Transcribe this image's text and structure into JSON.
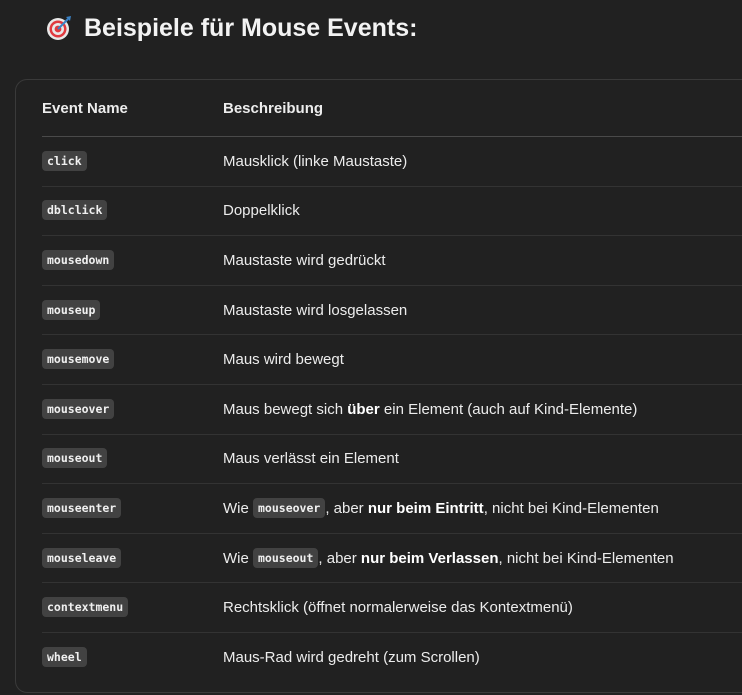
{
  "heading": {
    "icon": "direct-hit-target-icon",
    "title": "Beispiele für Mouse Events:"
  },
  "table": {
    "headers": [
      "Event Name",
      "Beschreibung"
    ],
    "rows": [
      {
        "event": "click",
        "description": [
          {
            "t": "Mausklick (linke Maustaste)"
          }
        ]
      },
      {
        "event": "dblclick",
        "description": [
          {
            "t": "Doppelklick"
          }
        ]
      },
      {
        "event": "mousedown",
        "description": [
          {
            "t": "Maustaste wird gedrückt"
          }
        ]
      },
      {
        "event": "mouseup",
        "description": [
          {
            "t": "Maustaste wird losgelassen"
          }
        ]
      },
      {
        "event": "mousemove",
        "description": [
          {
            "t": "Maus wird bewegt"
          }
        ]
      },
      {
        "event": "mouseover",
        "description": [
          {
            "t": "Maus bewegt sich "
          },
          {
            "b": "über"
          },
          {
            "t": " ein Element (auch auf Kind-Elemente)"
          }
        ]
      },
      {
        "event": "mouseout",
        "description": [
          {
            "t": "Maus verlässt ein Element"
          }
        ]
      },
      {
        "event": "mouseenter",
        "description": [
          {
            "t": "Wie "
          },
          {
            "c": "mouseover"
          },
          {
            "t": ", aber "
          },
          {
            "b": "nur beim Eintritt"
          },
          {
            "t": ", nicht bei Kind-Elementen"
          }
        ]
      },
      {
        "event": "mouseleave",
        "description": [
          {
            "t": "Wie "
          },
          {
            "c": "mouseout"
          },
          {
            "t": ", aber "
          },
          {
            "b": "nur beim Verlassen"
          },
          {
            "t": ", nicht bei Kind-Elementen"
          }
        ]
      },
      {
        "event": "contextmenu",
        "description": [
          {
            "t": "Rechtsklick (öffnet normalerweise das Kontextmenü)"
          }
        ]
      },
      {
        "event": "wheel",
        "description": [
          {
            "t": "Maus-Rad wird gedreht (zum Scrollen)"
          }
        ]
      }
    ]
  }
}
